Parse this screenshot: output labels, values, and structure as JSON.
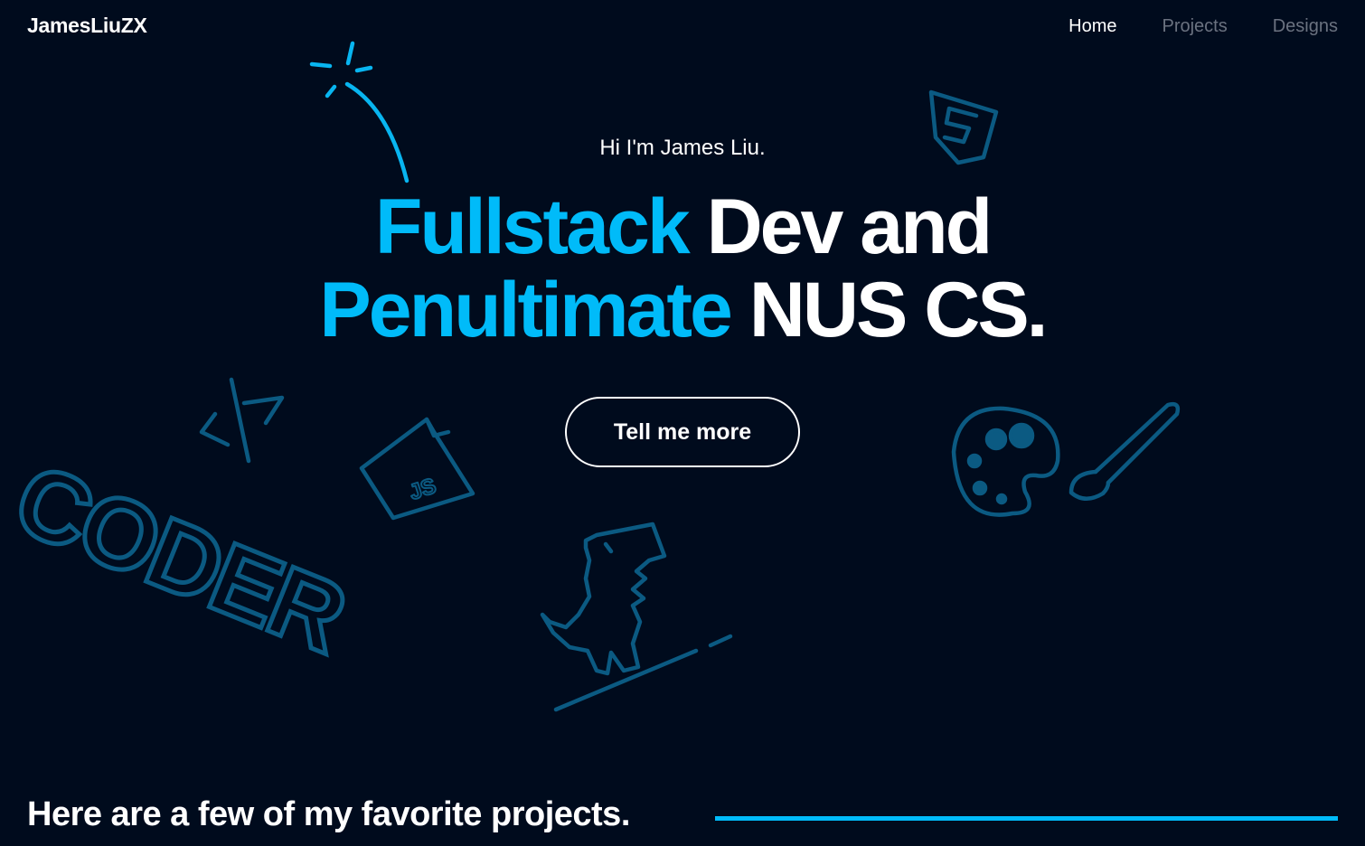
{
  "brand": "JamesLiuZX",
  "nav": {
    "home": "Home",
    "projects": "Projects",
    "designs": "Designs"
  },
  "hero": {
    "greeting": "Hi I'm James Liu.",
    "line1_accent": "Fullstack",
    "line1_rest": "Dev and",
    "line2_accent": "Penultimate",
    "line2_rest": "NUS CS.",
    "cta": "Tell me more"
  },
  "doodles": {
    "coder_text": "CODER",
    "js_label": "JS"
  },
  "projects_section": {
    "heading": "Here are a few of my favorite projects."
  },
  "colors": {
    "background": "#000b1d",
    "accent": "#00bbf9",
    "doodle": "#0b5a82",
    "nav_inactive": "#6b7280"
  },
  "icons": [
    "sparkle-icon",
    "code-icon",
    "js-file-icon",
    "html5-icon",
    "coder-text-doodle",
    "dinosaur-icon",
    "palette-icon",
    "paintbrush-icon"
  ]
}
